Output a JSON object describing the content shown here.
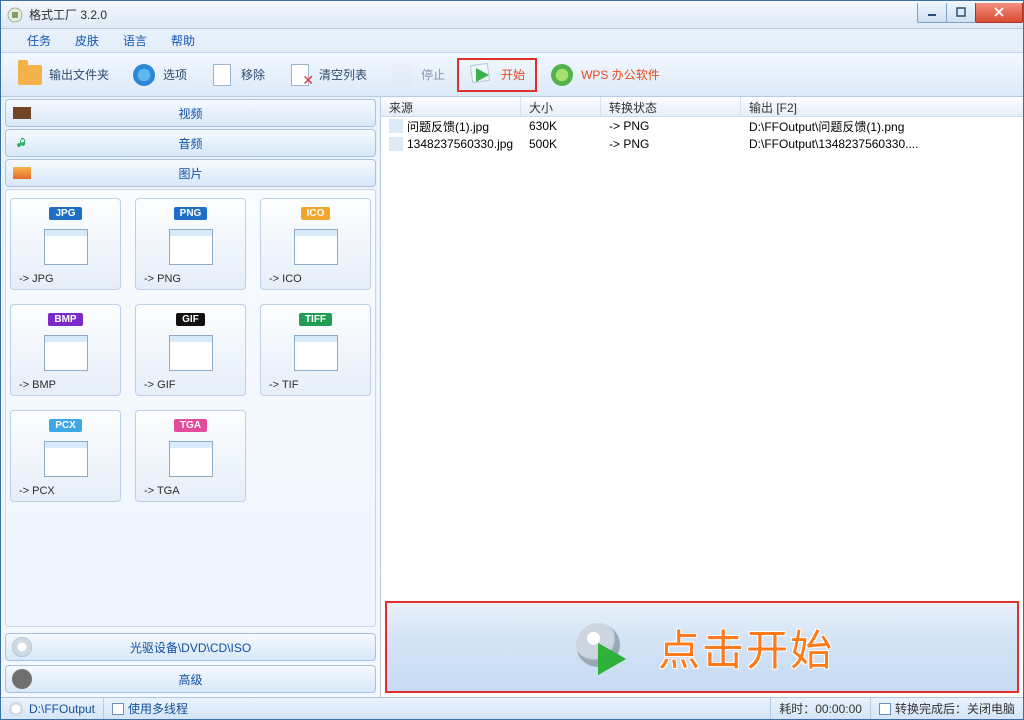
{
  "title": "格式工厂 3.2.0",
  "menus": [
    "任务",
    "皮肤",
    "语言",
    "帮助"
  ],
  "toolbar": {
    "output_folder": "输出文件夹",
    "options": "选项",
    "remove": "移除",
    "clear_list": "清空列表",
    "stop": "停止",
    "start": "开始",
    "wps": "WPS 办公软件"
  },
  "categories": {
    "video": "视频",
    "audio": "音频",
    "picture": "图片",
    "disc": "光驱设备\\DVD\\CD\\ISO",
    "advanced": "高级"
  },
  "formats": [
    {
      "pill": "JPG",
      "pill_bg": "#1f6fc7",
      "cap": "-> JPG"
    },
    {
      "pill": "PNG",
      "pill_bg": "#1f6fc7",
      "cap": "-> PNG"
    },
    {
      "pill": "ICO",
      "pill_bg": "#f0a52e",
      "cap": "-> ICO"
    },
    {
      "pill": "BMP",
      "pill_bg": "#7a2ac7",
      "cap": "-> BMP"
    },
    {
      "pill": "GIF",
      "pill_bg": "#111111",
      "cap": "-> GIF"
    },
    {
      "pill": "TIFF",
      "pill_bg": "#1f9e55",
      "cap": "-> TIF"
    },
    {
      "pill": "PCX",
      "pill_bg": "#3ea8e6",
      "cap": "-> PCX"
    },
    {
      "pill": "TGA",
      "pill_bg": "#e44b9b",
      "cap": "-> TGA"
    }
  ],
  "columns": {
    "src": "来源",
    "size": "大小",
    "state": "转换状态",
    "out": "输出 [F2]"
  },
  "rows": [
    {
      "src": "问题反馈(1).jpg",
      "size": "630K",
      "state": "-> PNG",
      "out": "D:\\FFOutput\\问题反馈(1).png"
    },
    {
      "src": "1348237560330.jpg",
      "size": "500K",
      "state": "-> PNG",
      "out": "D:\\FFOutput\\1348237560330...."
    }
  ],
  "banner": "点击开始",
  "status": {
    "output_path": "D:\\FFOutput",
    "multithread": "使用多线程",
    "elapsed_label": "耗时：",
    "elapsed_value": "00:00:00",
    "after_label": "转换完成后：",
    "after_value": "关闭电脑"
  }
}
